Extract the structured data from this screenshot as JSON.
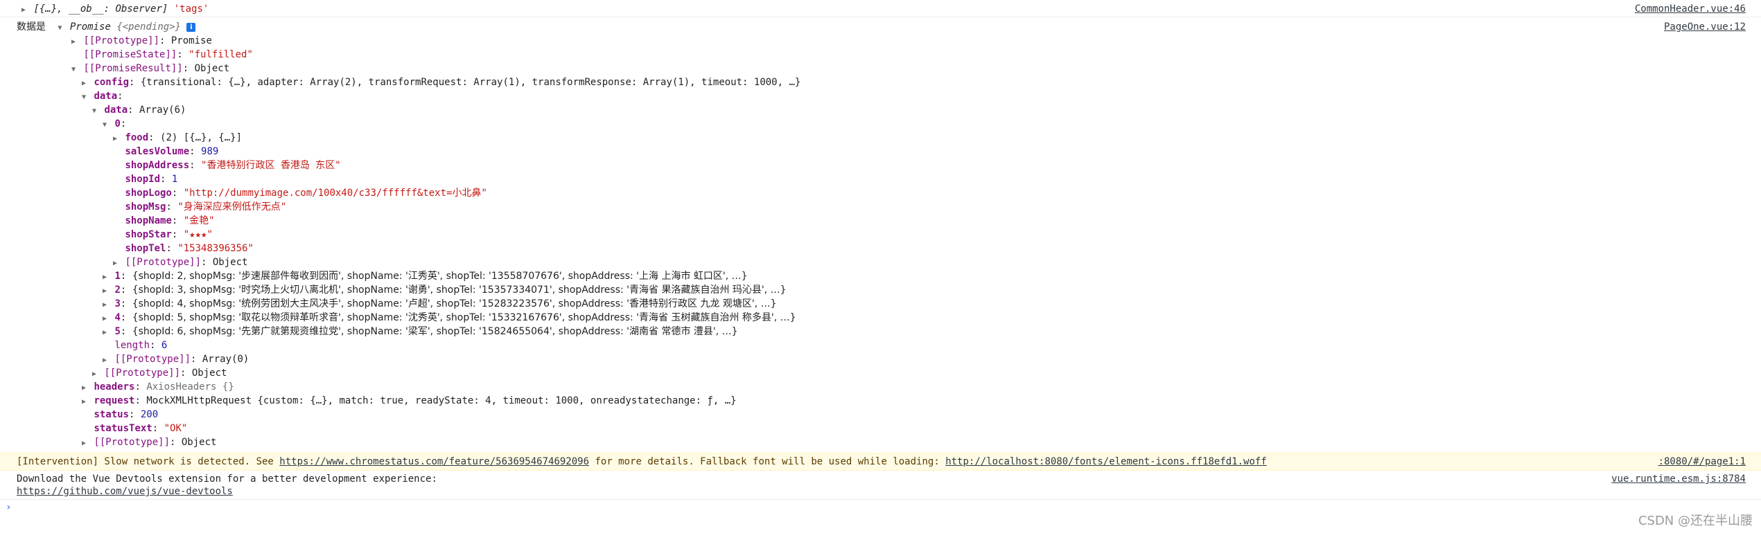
{
  "console": {
    "line1": {
      "text_a": "[{…}, __ob__: Observer]",
      "text_b": "'tags'",
      "source": "CommonHeader.vue:46"
    },
    "line2": {
      "label": "数据是",
      "promise": "Promise",
      "pending": "{<pending>}",
      "info_badge": "i",
      "source": "PageOne.vue:12"
    },
    "tree": {
      "prototype_promise_key": "[[Prototype]]",
      "prototype_promise_val": "Promise",
      "state_key": "[[PromiseState]]",
      "state_val": "\"fulfilled\"",
      "result_key": "[[PromiseResult]]",
      "result_val": "Object",
      "config_key": "config",
      "config_val": "{transitional: {…}, adapter: Array(2), transformRequest: Array(1), transformResponse: Array(1), timeout: 1000, …}",
      "data_key": "data",
      "data_inner_key": "data",
      "data_inner_val": "Array(6)",
      "idx0_key": "0",
      "food_key": "food",
      "food_val": "(2) [{…}, {…}]",
      "salesVolume_key": "salesVolume",
      "salesVolume_val": "989",
      "shopAddress_key": "shopAddress",
      "shopAddress_val": "\"香港特别行政区 香港岛 东区\"",
      "shopId_key": "shopId",
      "shopId_val": "1",
      "shopLogo_key": "shopLogo",
      "shopLogo_val": "\"http://dummyimage.com/100x40/c33/ffffff&text=小北鼻\"",
      "shopMsg_key": "shopMsg",
      "shopMsg_val": "\"身海深应来例低作无点\"",
      "shopName_key": "shopName",
      "shopName_val": "\"金艳\"",
      "shopStar_key": "shopStar",
      "shopStar_val": "\"★★★\"",
      "shopTel_key": "shopTel",
      "shopTel_val": "\"15348396356\"",
      "proto_object_key": "[[Prototype]]",
      "proto_object_val": "Object",
      "rows": [
        {
          "idx": "1",
          "text": "{shopId: 2, shopMsg: '步速展部件每收到因而', shopName: '江秀英', shopTel: '13558707676', shopAddress: '上海 上海市 虹口区', …}"
        },
        {
          "idx": "2",
          "text": "{shopId: 3, shopMsg: '时究场上火切八离北机', shopName: '谢勇', shopTel: '15357334071', shopAddress: '青海省 果洛藏族自治州 玛沁县', …}"
        },
        {
          "idx": "3",
          "text": "{shopId: 4, shopMsg: '统例劳团划大主风决手', shopName: '卢超', shopTel: '15283223576', shopAddress: '香港特别行政区 九龙 观塘区', …}"
        },
        {
          "idx": "4",
          "text": "{shopId: 5, shopMsg: '取花以物须辩革听求音', shopName: '沈秀英', shopTel: '15332167676', shopAddress: '青海省 玉树藏族自治州 称多县', …}"
        },
        {
          "idx": "5",
          "text": "{shopId: 6, shopMsg: '先第广就第规资维拉党', shopName: '梁军', shopTel: '15824655064', shopAddress: '湖南省 常德市 澧县', …}"
        }
      ],
      "length_key": "length",
      "length_val": "6",
      "proto_array_key": "[[Prototype]]",
      "proto_array_val": "Array(0)",
      "proto_data_key": "[[Prototype]]",
      "proto_data_val": "Object",
      "headers_key": "headers",
      "headers_val": "AxiosHeaders {}",
      "request_key": "request",
      "request_val": "MockXMLHttpRequest {custom: {…}, match: true, readyState: 4, timeout: 1000, onreadystatechange: ƒ, …}",
      "status_key": "status",
      "status_val": "200",
      "statusText_key": "statusText",
      "statusText_val": "\"OK\"",
      "proto_result_key": "[[Prototype]]",
      "proto_result_val": "Object"
    },
    "warning": {
      "prefix": "[Intervention] Slow network is detected. See ",
      "link1": "https://www.chromestatus.com/feature/5636954674692096",
      "middle": " for more details. Fallback font will be used while loading: ",
      "link2": "http://localhost:8080/fonts/element-icons.ff18efd1.woff",
      "source": ":8080/#/page1:1"
    },
    "devtools": {
      "line1": "Download the Vue Devtools extension for a better development experience:",
      "link": "https://github.com/vuejs/vue-devtools",
      "source": "vue.runtime.esm.js:8784"
    },
    "prompt": "›"
  },
  "watermark": "CSDN @还在半山腰",
  "icons": {
    "expanded": "triangle-down-icon",
    "collapsed": "triangle-right-icon",
    "info": "info-icon",
    "prompt": "prompt-chevron-icon"
  },
  "colors": {
    "key": "#881280",
    "string": "#c41a16",
    "number": "#1a1aa6",
    "warning_bg": "#fffbe5",
    "info_badge": "#1a73e8"
  }
}
